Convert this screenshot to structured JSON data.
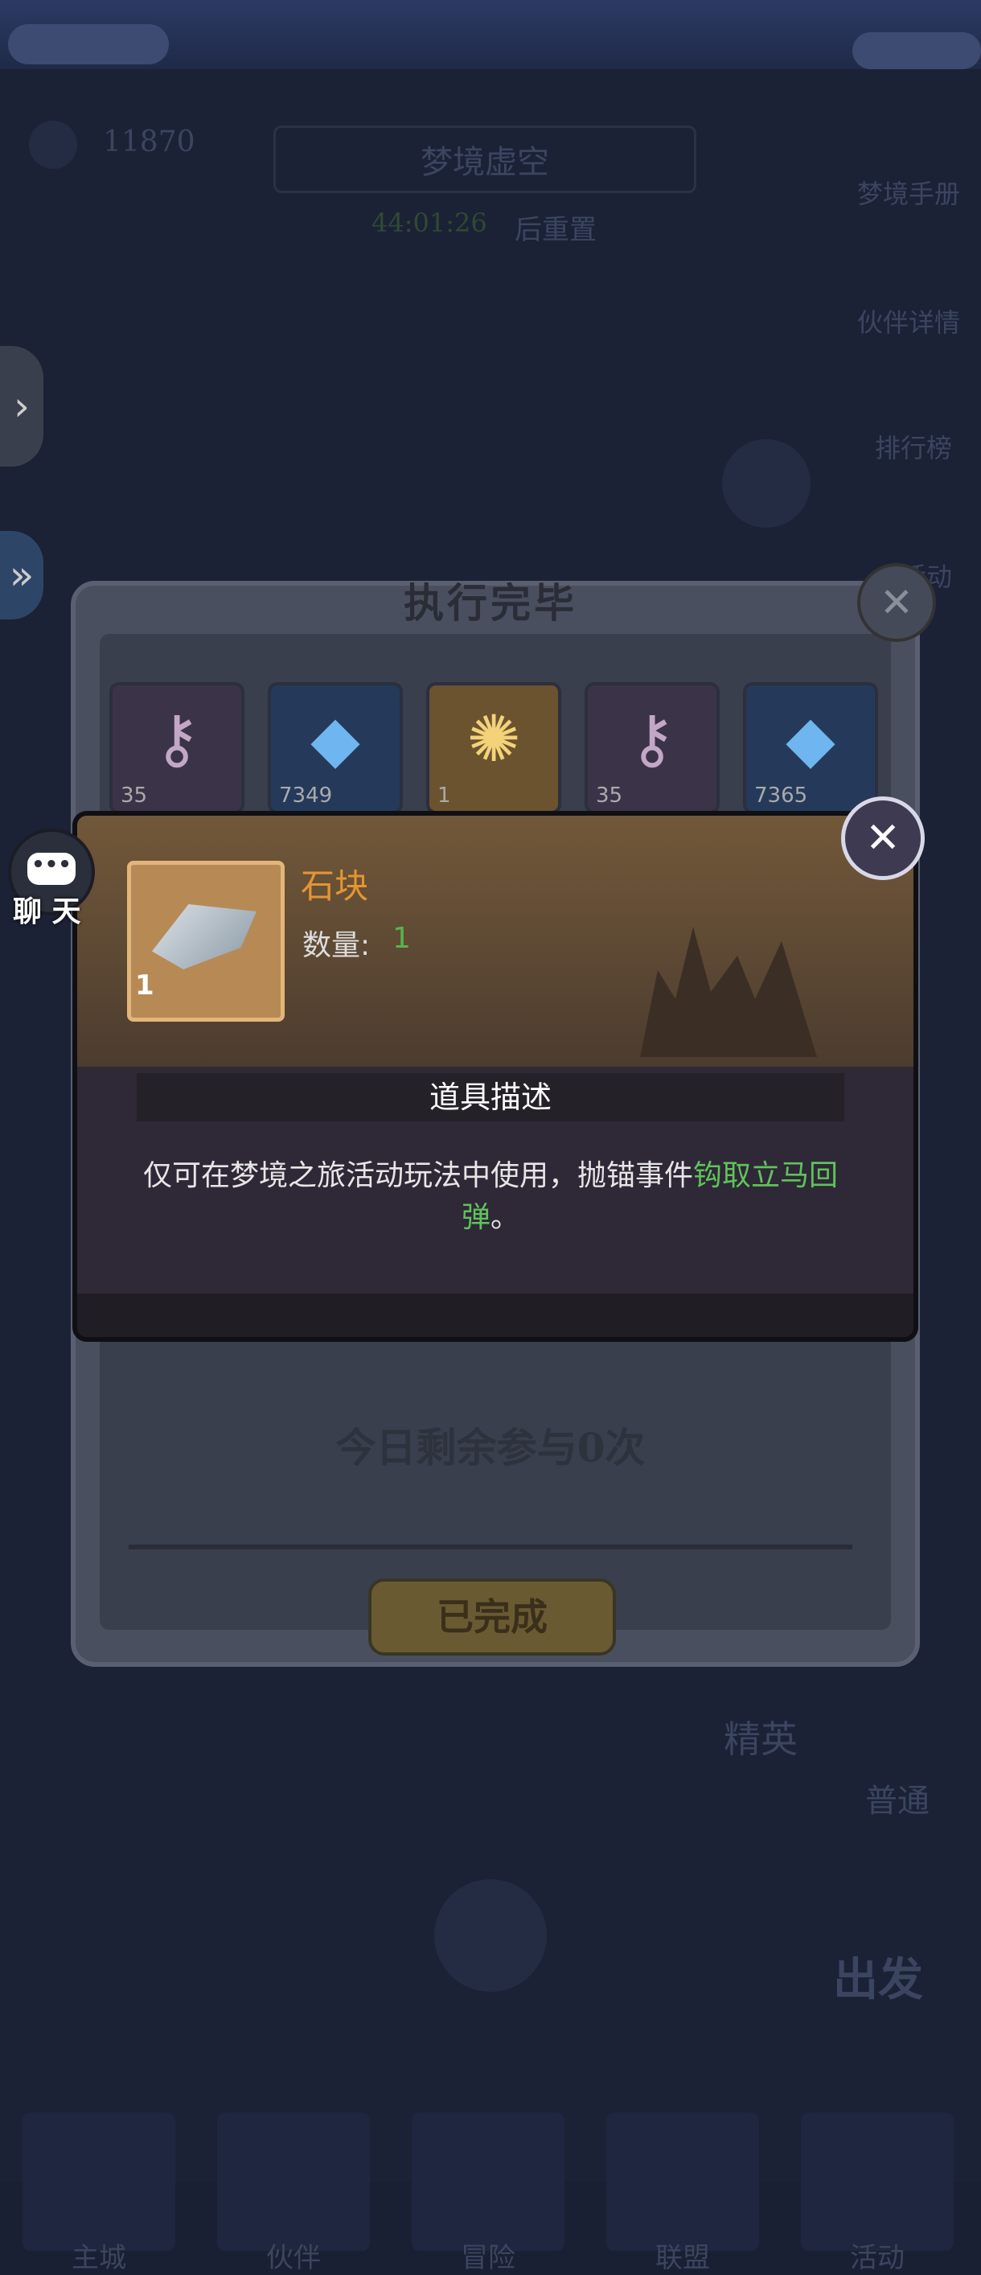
{
  "hud": {
    "currency": "11870",
    "mode_title": "梦境虚空",
    "reset_time": "44:01:26",
    "reset_suffix": "后重置",
    "right_menu": [
      "梦境手册",
      "伙伴详情",
      "排行榜",
      "活动"
    ],
    "elite_label": "精英",
    "normal_label": "普通",
    "depart_label": "出发"
  },
  "bottom_nav": [
    "主城",
    "伙伴",
    "冒险",
    "联盟",
    "活动"
  ],
  "result_panel": {
    "title": "执行完毕",
    "rewards": [
      {
        "icon": "key-icon",
        "qty": "35",
        "rarity": "purple"
      },
      {
        "icon": "crystal-icon",
        "qty": "7349",
        "rarity": "blue"
      },
      {
        "icon": "orb-icon",
        "qty": "1",
        "rarity": "orange"
      },
      {
        "icon": "key-icon",
        "qty": "35",
        "rarity": "purple"
      },
      {
        "icon": "crystal-icon",
        "qty": "7365",
        "rarity": "blue"
      }
    ],
    "remaining": "今日剩余参与0次",
    "done_button": "已完成"
  },
  "item_detail": {
    "icon": "stone-icon",
    "icon_qty": "1",
    "name": "石块",
    "count_label": "数量:",
    "count_value": "1",
    "desc_title": "道具描述",
    "desc_plain": "仅可在梦境之旅活动玩法中使用，抛锚事件",
    "desc_highlight": "钩取立马回弹",
    "desc_end": "。"
  },
  "chat": {
    "label": "聊 天",
    "bubble": "•••"
  },
  "colors": {
    "item_name": "#e49532",
    "highlight": "#5fc35a"
  }
}
